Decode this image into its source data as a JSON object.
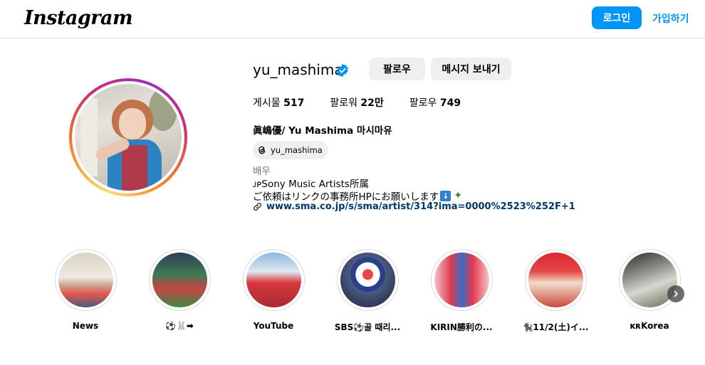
{
  "header": {
    "logo_text": "Instagram",
    "login_label": "로그인",
    "signup_label": "가입하기",
    "brand_color": "#0095f6"
  },
  "profile": {
    "username": "yu_mashima",
    "verified": true,
    "follow_label": "팔로우",
    "message_label": "메시지 보내기",
    "stats": [
      {
        "label": "게시물",
        "value": "517"
      },
      {
        "label": "팔로워",
        "value": "22만"
      },
      {
        "label": "팔로우",
        "value": "749"
      }
    ],
    "full_name": "眞嶋優/ Yu Mashima 마시마유",
    "threads_handle": "yu_mashima",
    "category": "배우",
    "bio_line1": "ᴊᴘSony Music Artists所属",
    "bio_line2": "ご依頼はリンクの事務所HPにお願いします",
    "link": "www.sma.co.jp/s/sma/artist/314?ima=0000%2523%252F+1"
  },
  "highlights": [
    {
      "label": "News"
    },
    {
      "label": "⚽️🐰➡"
    },
    {
      "label": "YouTube"
    },
    {
      "label": "SBS⚽️골 때리..."
    },
    {
      "label": "KIRIN勝利の..."
    },
    {
      "label": "🐈‍⬛11/2(土)イ..."
    },
    {
      "label": "ᴋʀKorea"
    }
  ],
  "icons": {
    "verified": "verified-badge-icon",
    "threads": "threads-icon",
    "link": "link-icon",
    "next": "chevron-right-icon"
  }
}
